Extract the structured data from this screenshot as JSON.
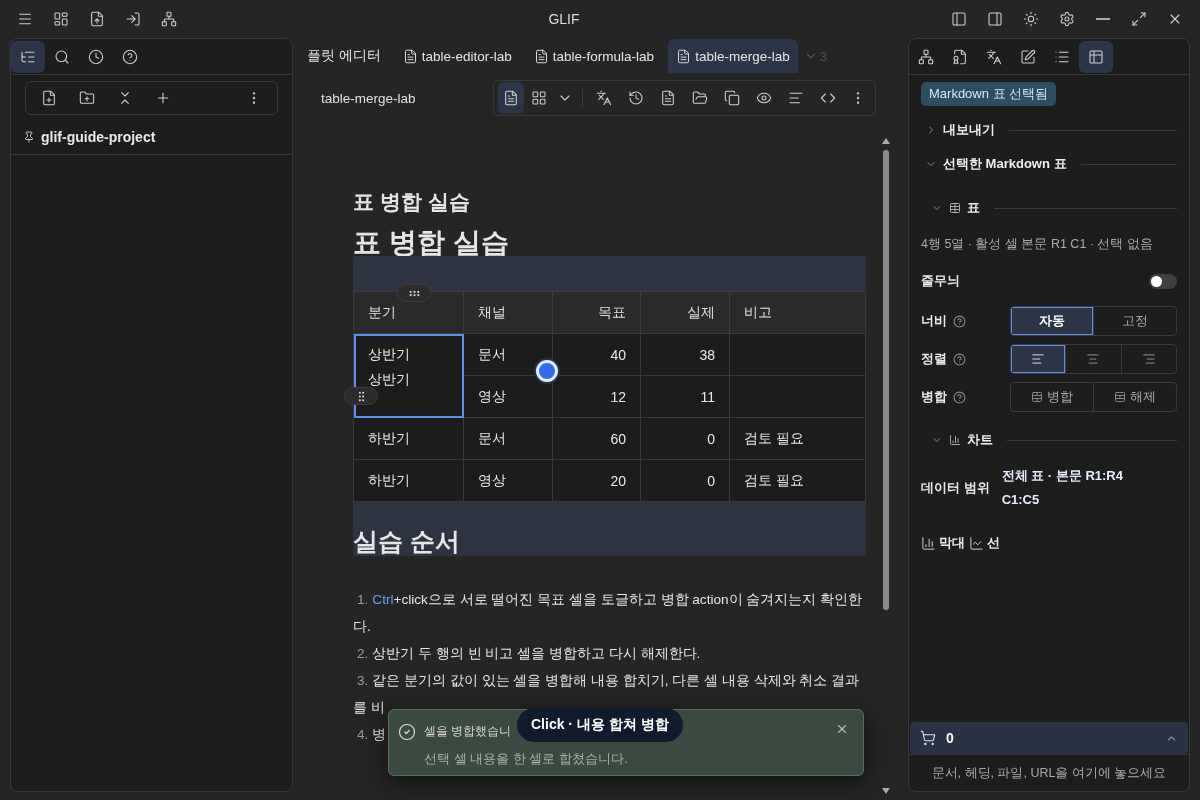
{
  "window": {
    "title": "GLIF"
  },
  "left_panel": {
    "tabs": [
      {
        "kind": "tree",
        "selected": true
      },
      {
        "kind": "search",
        "selected": false
      },
      {
        "kind": "history",
        "selected": false
      },
      {
        "kind": "help",
        "selected": false
      }
    ],
    "project": "glif-guide-project"
  },
  "editor_tabs": [
    {
      "label": "플릿 에디터",
      "icon": false,
      "selected": false
    },
    {
      "label": "table-editor-lab",
      "icon": true,
      "selected": false
    },
    {
      "label": "table-formula-lab",
      "icon": true,
      "selected": false
    },
    {
      "label": "table-merge-lab",
      "icon": true,
      "selected": true
    }
  ],
  "overflow_count": "3",
  "doc_title": "table-merge-lab",
  "view_mode": {
    "document_selected": true
  },
  "document": {
    "heading_small": "표 병합 실습",
    "heading_large": "표 병합 실습",
    "table": {
      "columns": [
        {
          "label": "분기",
          "kind": "text"
        },
        {
          "label": "채널",
          "kind": "text"
        },
        {
          "label": "목표",
          "kind": "number"
        },
        {
          "label": "실제",
          "kind": "number"
        },
        {
          "label": "비고",
          "kind": "text"
        }
      ],
      "rows": [
        {
          "cells": [
            {
              "lines": [
                "상반기",
                "상반기"
              ],
              "merged": true,
              "rowspan": 2,
              "selected": true
            },
            {
              "lines": [
                "문서"
              ],
              "merged": false,
              "selected": false
            },
            {
              "lines": [
                "40"
              ],
              "merged": false,
              "selected": false
            },
            {
              "lines": [
                "38"
              ],
              "merged": false,
              "selected": false
            },
            {
              "merged": false,
              "selected": false
            }
          ]
        },
        {
          "cells": [
            {
              "lines": [
                "영상"
              ],
              "merged": false,
              "selected": false
            },
            {
              "lines": [
                "12"
              ],
              "merged": false,
              "selected": false
            },
            {
              "lines": [
                "11"
              ],
              "merged": false,
              "selected": false
            },
            {
              "merged": false,
              "selected": false
            }
          ]
        },
        {
          "cells": [
            {
              "lines": [
                "하반기"
              ],
              "merged": false,
              "selected": false
            },
            {
              "lines": [
                "문서"
              ],
              "merged": false,
              "selected": false
            },
            {
              "lines": [
                "60"
              ],
              "merged": false,
              "selected": false
            },
            {
              "lines": [
                "0"
              ],
              "merged": false,
              "selected": false
            },
            {
              "lines": [
                "검토 필요"
              ],
              "merged": false,
              "selected": false
            }
          ]
        },
        {
          "cells": [
            {
              "lines": [
                "하반기"
              ],
              "merged": false,
              "selected": false
            },
            {
              "lines": [
                "영상"
              ],
              "merged": false,
              "selected": false
            },
            {
              "lines": [
                "20"
              ],
              "merged": false,
              "selected": false
            },
            {
              "lines": [
                "0"
              ],
              "merged": false,
              "selected": false
            },
            {
              "lines": [
                "검토 필요"
              ],
              "merged": false,
              "selected": false
            }
          ]
        }
      ]
    },
    "section_heading": "실습 순서",
    "steps": [
      {
        "number": "1.",
        "key": "Ctrl",
        "text": "+click으로 서로 떨어진 목표 셀을 토글하고 병합 action이 숨겨지는지 확인한다."
      },
      {
        "number": "2.",
        "text": "상반기 두 행의 빈 비고 셀을 병합하고 다시 해제한다."
      },
      {
        "number": "3.",
        "text": "같은 분기의 값이 있는 셀을 병합해 내용 합치기, 다른 셀 내용 삭제와 취소 결과를 비"
      },
      {
        "number": "4.",
        "text": "병"
      }
    ]
  },
  "toast": {
    "title": "셀을 병합했습니",
    "message": "선택 셀 내용을 한 셀로 합쳤습니다."
  },
  "tooltip": "Click · 내용 합쳐 병합",
  "right_panel": {
    "tabs": [
      {
        "kind": "structure",
        "selected": false
      },
      {
        "kind": "file",
        "selected": false
      },
      {
        "kind": "translate",
        "selected": false
      },
      {
        "kind": "edit",
        "selected": false
      },
      {
        "kind": "list",
        "selected": false
      },
      {
        "kind": "table",
        "selected": true
      }
    ],
    "badge": "Markdown 표 선택됨",
    "sections": [
      {
        "label": "내보내기",
        "expanded": false
      },
      {
        "label": "선택한 Markdown 표",
        "expanded": true
      }
    ],
    "table_group": {
      "label": "표",
      "expanded": true
    },
    "info": "4행 5열 · 활성 셀 본문 R1 C1 · 선택 없음",
    "stripes": {
      "label": "줄무늬",
      "on": false
    },
    "width": {
      "label": "너비",
      "options": [
        {
          "label": "자동",
          "selected": true
        },
        {
          "label": "고정",
          "selected": false
        }
      ]
    },
    "align": {
      "label": "정렬",
      "options": [
        {
          "kind": "left",
          "selected": true
        },
        {
          "kind": "center",
          "selected": false
        },
        {
          "kind": "right",
          "selected": false
        }
      ]
    },
    "merge": {
      "label": "병합",
      "actions": [
        {
          "kind": "merge",
          "label": "병합"
        },
        {
          "kind": "split",
          "label": "해제"
        }
      ]
    },
    "chart_group": {
      "label": "차트",
      "expanded": true
    },
    "data_range": {
      "label": "데이터 범위",
      "value": "전체 표 · 본문 R1:R4 C1:C5"
    },
    "chart_types": [
      {
        "kind": "bar",
        "label": "막대"
      },
      {
        "kind": "line",
        "label": "선"
      }
    ]
  },
  "cart": {
    "count": "0",
    "expanded": false,
    "hint": "문서, 헤딩, 파일, URL을 여기에 놓으세요"
  }
}
